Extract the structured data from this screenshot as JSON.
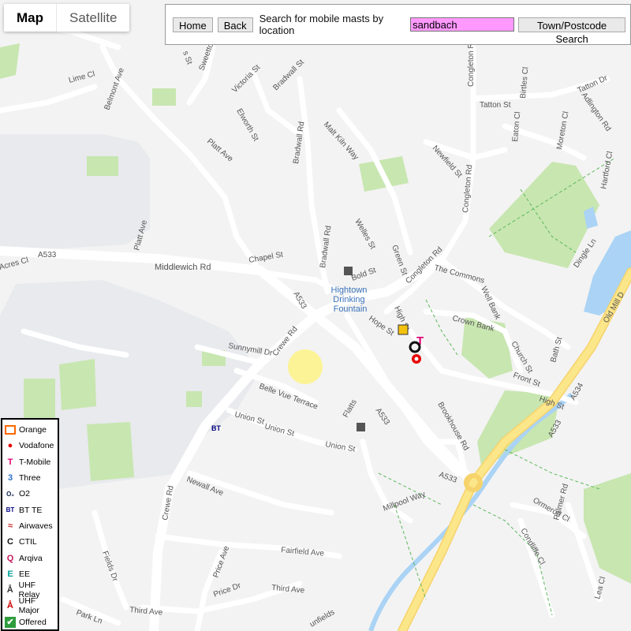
{
  "map_controls": {
    "map_label": "Map",
    "satellite_label": "Satellite"
  },
  "search_bar": {
    "home_label": "Home",
    "back_label": "Back",
    "prompt": "Search for mobile masts by location",
    "query": "sandbach",
    "town_search_label": "Town/Postcode Search"
  },
  "legend": [
    {
      "label": "Orange",
      "icon": "orange-icon",
      "color": "#ff6600"
    },
    {
      "label": "Vodafone",
      "icon": "vodafone-icon",
      "color": "#e60000"
    },
    {
      "label": "T-Mobile",
      "icon": "tmobile-icon",
      "color": "#e20074"
    },
    {
      "label": "Three",
      "icon": "three-icon",
      "color": "#2b73c9"
    },
    {
      "label": "O2",
      "icon": "o2-icon",
      "color": "#0b1e4a"
    },
    {
      "label": "BT TE",
      "icon": "bt-icon",
      "color": "#000080"
    },
    {
      "label": "Airwaves",
      "icon": "airwaves-icon",
      "color": "#c62828"
    },
    {
      "label": "CTIL",
      "icon": "ctil-icon",
      "color": "#111111"
    },
    {
      "label": "Arqiva",
      "icon": "arqiva-icon",
      "color": "#c2185b"
    },
    {
      "label": "EE",
      "icon": "ee-icon",
      "color": "#00a19a"
    },
    {
      "label": "UHF Relay",
      "icon": "uhf-relay-icon",
      "color": "#333333"
    },
    {
      "label": "UHF Major",
      "icon": "uhf-major-icon",
      "color": "#cc0000"
    },
    {
      "label": "Offered",
      "icon": "offered-icon",
      "color": "#2e9d3c"
    }
  ],
  "map": {
    "poi": "Hightown Drinking Fountain",
    "roads": {
      "a533_west": "A533",
      "middlewich": "Middlewich Rd",
      "a533_mid": "A533",
      "a533_south": "A533",
      "a533_east": "A533",
      "a534": "A534",
      "a533_se": "A533",
      "crewe_rd_n": "Crewe Rd",
      "crewe_rd_s": "Crewe Rd",
      "congleton_n": "Congleton Rd",
      "congleton_c": "Congleton Rd",
      "old_mill": "Old Mill D",
      "lime": "Lime Cl",
      "belmont": "Belmont Ave",
      "platt": "Platt Ave",
      "platt2": "Platt Ave",
      "victoria": "Victoria St",
      "elworth": "Elworth St",
      "bradwall_st": "Bradwall St",
      "bradwall_rd": "Bradwall Rd",
      "bradwall_rd2": "Bradwall Rd",
      "malt": "Malt Kiln Way",
      "newfield": "Newfield St",
      "wellies": "Welles St",
      "chapel": "Chapel St",
      "bold": "Bold St",
      "green": "Green St",
      "commons": "The Commons",
      "high": "High St",
      "high2": "High St",
      "hope": "Hope St",
      "crown": "Crown Bank",
      "well": "Well Bank",
      "church": "Church St",
      "front": "Front St",
      "bath": "Bath St",
      "sunnymill": "Sunnymill Dr",
      "belle": "Belle Vue Terrace",
      "union": "Union St",
      "union2": "Union St",
      "union3": "Union St",
      "flatts": "Flatts",
      "brookhouse": "Brookhouse Rd",
      "newall": "Newall Ave",
      "millpool": "Millpool Way",
      "fairfield": "Fairfield Ave",
      "price": "Price Ave",
      "price_dr": "Price Dr",
      "third": "Third Ave",
      "third2": "Third Ave",
      "park": "Park Ln",
      "fields": "Fields Dr",
      "ormerod": "Ormerod Cl",
      "condliffe": "Condliffe Cl",
      "palmer": "Palmer Rd",
      "lea": "Lea Cl",
      "tatton_st": "Tatton St",
      "tatton_dr": "Tatton Dr",
      "adlington": "Adlington Rd",
      "birtles": "Birtles Cl",
      "eaton": "Eaton Cl",
      "moreton": "Moreton Cl",
      "hartford": "Hartford Cl",
      "dingle": "Dingle Ln",
      "acres": "Acres Cl",
      "sweet": "Sweetto",
      "bradwall_st2": "s St",
      "unfields": "unfields"
    }
  },
  "colors": {
    "major_road": "#fce68a",
    "water": "#aad3f5",
    "park": "#c8e6b0",
    "search_highlight": "#ff99ff"
  }
}
